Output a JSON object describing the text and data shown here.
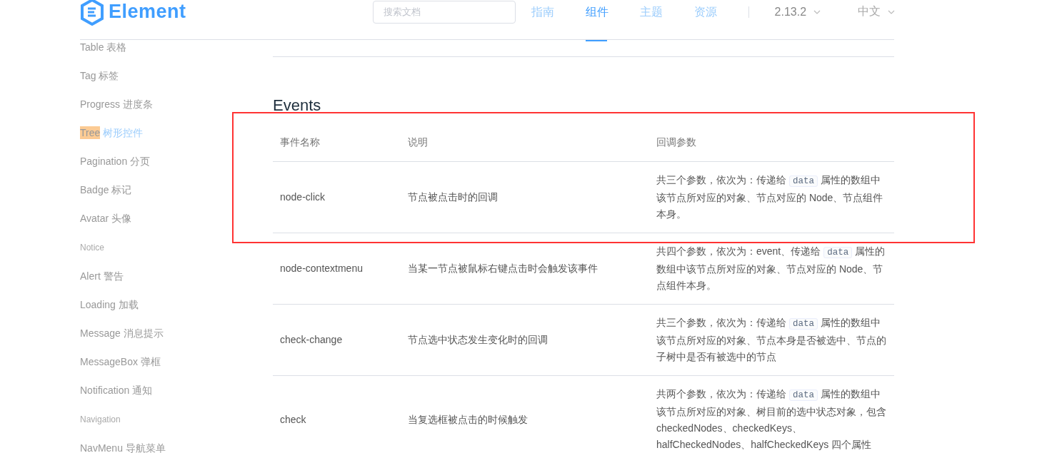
{
  "header": {
    "logo": "Element",
    "search": {
      "placeholder": "搜索文档"
    },
    "nav": [
      {
        "label": "指南",
        "selected": false
      },
      {
        "label": "组件",
        "selected": true
      },
      {
        "label": "主题",
        "selected": false
      },
      {
        "label": "资源",
        "selected": false
      }
    ],
    "version": "2.13.2",
    "language": "中文"
  },
  "sidebar": [
    {
      "kind": "item",
      "label": "Table 表格",
      "selected": false
    },
    {
      "kind": "item",
      "label": "Tag 标签",
      "selected": false
    },
    {
      "kind": "item",
      "label": "Progress 进度条",
      "selected": false
    },
    {
      "kind": "item",
      "highlight": "Tree",
      "label": "树形控件",
      "selected": true
    },
    {
      "kind": "item",
      "label": "Pagination 分页",
      "selected": false
    },
    {
      "kind": "item",
      "label": "Badge 标记",
      "selected": false
    },
    {
      "kind": "item",
      "label": "Avatar 头像",
      "selected": false
    },
    {
      "kind": "group",
      "label": "Notice"
    },
    {
      "kind": "item",
      "label": "Alert 警告",
      "selected": false
    },
    {
      "kind": "item",
      "label": "Loading 加载",
      "selected": false
    },
    {
      "kind": "item",
      "label": "Message 消息提示",
      "selected": false
    },
    {
      "kind": "item",
      "label": "MessageBox 弹框",
      "selected": false
    },
    {
      "kind": "item",
      "label": "Notification 通知",
      "selected": false
    },
    {
      "kind": "group",
      "label": "Navigation"
    },
    {
      "kind": "item",
      "label": "NavMenu 导航菜单",
      "selected": false
    }
  ],
  "section": {
    "title": "Events",
    "columns": [
      "事件名称",
      "说明",
      "回调参数"
    ],
    "rows": [
      {
        "name": "node-click",
        "description": "节点被点击时的回调",
        "params": {
          "before": "共三个参数，依次为：传递给 ",
          "code": "data",
          "after": " 属性的数组中该节点所对应的对象、节点对应的 Node、节点组件本身。"
        }
      },
      {
        "name": "node-contextmenu",
        "description": "当某一节点被鼠标右键点击时会触发该事件",
        "params": {
          "before": "共四个参数，依次为：event、传递给 ",
          "code": "data",
          "after": " 属性的数组中该节点所对应的对象、节点对应的 Node、节点组件本身。"
        }
      },
      {
        "name": "check-change",
        "description": "节点选中状态发生变化时的回调",
        "params": {
          "before": "共三个参数，依次为：传递给 ",
          "code": "data",
          "after": " 属性的数组中该节点所对应的对象、节点本身是否被选中、节点的子树中是否有被选中的节点"
        }
      },
      {
        "name": "check",
        "description": "当复选框被点击的时候触发",
        "params": {
          "before": "共两个参数，依次为：传递给 ",
          "code": "data",
          "after": " 属性的数组中该节点所对应的对象、树目前的选中状态对象，包含 checkedNodes、checkedKeys、halfCheckedNodes、halfCheckedKeys 四个属性"
        }
      }
    ]
  }
}
